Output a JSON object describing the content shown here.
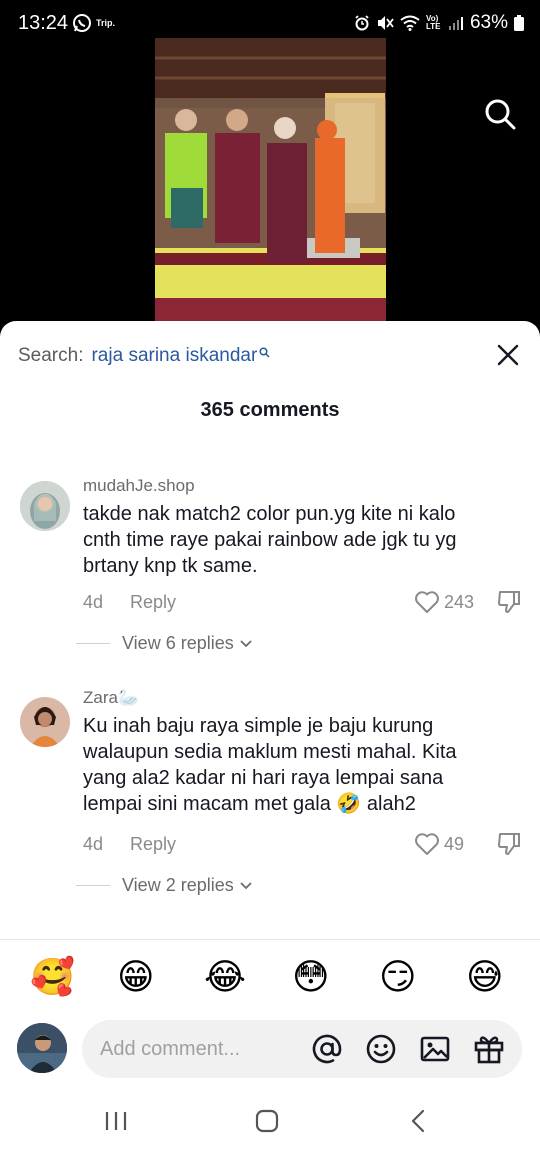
{
  "status_bar": {
    "time": "13:24",
    "trip_label": "Trip.",
    "volte_label": "Vo) LTE",
    "battery": "63%"
  },
  "search": {
    "label": "Search:",
    "query": "raja sarina iskandar"
  },
  "comments_header": "365 comments",
  "comments": [
    {
      "username": "mudahJe.shop",
      "lines": [
        "takde nak match2 color pun.yg kite ni kalo",
        "cnth time raye pakai rainbow ade jgk tu yg",
        "brtany knp tk same."
      ],
      "age": "4d",
      "reply_label": "Reply",
      "likes": "243",
      "view_replies": "View 6 replies"
    },
    {
      "username": "Zara🦢",
      "lines": [
        "Ku inah baju raya simple je baju kurung",
        "walaupun sedia maklum mesti mahal. Kita",
        "yang ala2 kadar ni hari raya lempai sana",
        "lempai sini macam met gala 🤣 alah2"
      ],
      "age": "4d",
      "reply_label": "Reply",
      "likes": "49",
      "view_replies": "View 2 replies"
    }
  ],
  "emoji_bar": [
    "🥰",
    "😁",
    "😂",
    "😳",
    "😏",
    "😅"
  ],
  "composer": {
    "placeholder": "Add comment..."
  },
  "colors": {
    "query_blue": "#2a5a9e",
    "text_primary": "#161823",
    "text_secondary": "#8a8a8a"
  }
}
